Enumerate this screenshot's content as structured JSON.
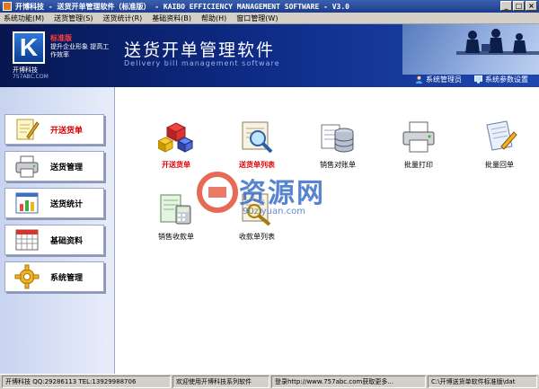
{
  "window": {
    "title": "开博科技 - 送货开单管理软件（标准版） - KAIBO EFFICIENCY MANAGEMENT SOFTWARE - V3.0",
    "controls": [
      "_",
      "□",
      "×"
    ]
  },
  "menu": [
    {
      "label": "系统功能(M)"
    },
    {
      "label": "送货管理(S)"
    },
    {
      "label": "送货统计(R)"
    },
    {
      "label": "基础资料(B)"
    },
    {
      "label": "帮助(H)"
    },
    {
      "label": "窗口管理(W)"
    }
  ],
  "header": {
    "logo_letter": "K",
    "edition_badge": "标准版",
    "slogan": "提升企业形象 提高工作效率",
    "company": "开博科技",
    "website": "757ABC.COM",
    "title": "送货开单管理软件",
    "subtitle": "Delivery bill management software",
    "links": [
      {
        "label": "系统管理员",
        "icon": "user-icon"
      },
      {
        "label": "系统参数设置",
        "icon": "monitor-icon"
      }
    ]
  },
  "sidebar": {
    "items": [
      {
        "label": "开送货单",
        "icon": "pencil-note-icon",
        "active": true
      },
      {
        "label": "送货管理",
        "icon": "printer-icon",
        "active": false
      },
      {
        "label": "送货统计",
        "icon": "bar-chart-icon",
        "active": false
      },
      {
        "label": "基础资料",
        "icon": "calendar-grid-icon",
        "active": false
      },
      {
        "label": "系统管理",
        "icon": "gear-icon",
        "active": false
      }
    ]
  },
  "tiles": [
    {
      "label": "开送货单",
      "icon": "cubes-icon",
      "highlight": true
    },
    {
      "label": "送货单列表",
      "icon": "magnifier-icon",
      "highlight": true
    },
    {
      "label": "销售对账单",
      "icon": "database-icon",
      "highlight": false
    },
    {
      "label": "批量打印",
      "icon": "printer-icon",
      "highlight": false
    },
    {
      "label": "批量回单",
      "icon": "document-pencil-icon",
      "highlight": false
    },
    {
      "label": "销售收款单",
      "icon": "receipt-calculator-icon",
      "highlight": false
    },
    {
      "label": "收款单列表",
      "icon": "magnifier-list-icon",
      "highlight": false
    }
  ],
  "watermark": {
    "text": "资源网",
    "url": "90ziyuan.com"
  },
  "statusbar": {
    "cells": [
      "开博科技 QQ:29286113 TEL:13929988706",
      "欢迎使用开博科技系列软件",
      "登录http://www.757abc.com获取更多...",
      "C:\\开博送货单软件标准版\\dat"
    ]
  },
  "colors": {
    "header_bg": "#0d2a84",
    "active_red": "#e00000",
    "sidebar_bg": "#c8d3ef"
  }
}
